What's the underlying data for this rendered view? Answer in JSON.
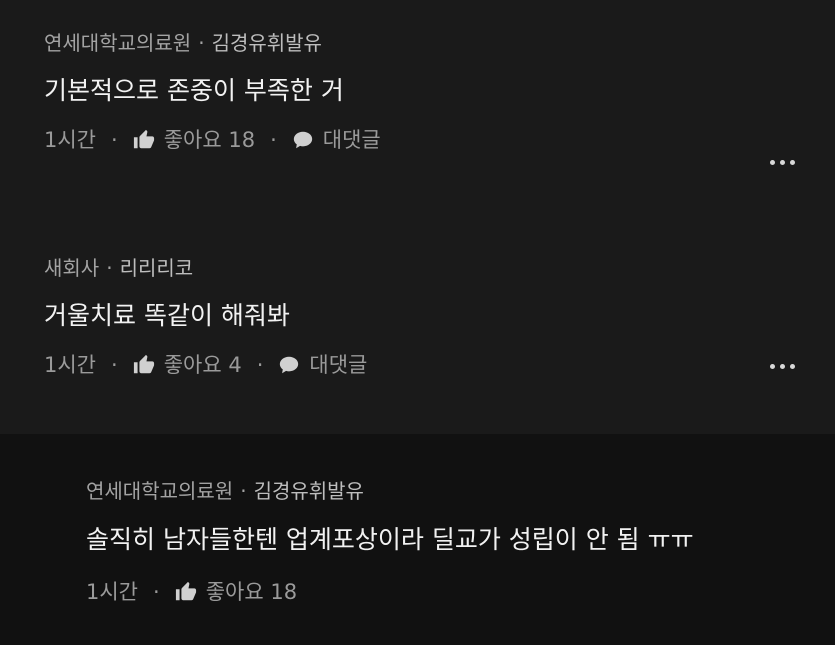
{
  "comments": [
    {
      "org": "연세대학교의료원",
      "author": "김경유휘발유",
      "text": "기본적으로 존중이 부족한 거",
      "time": "1시간",
      "like_label": "좋아요",
      "like_count": "18",
      "reply_label": "대댓글"
    },
    {
      "org": "새회사",
      "author": "리리리코",
      "text": "거울치료 똑같이 해줘봐",
      "time": "1시간",
      "like_label": "좋아요",
      "like_count": "4",
      "reply_label": "대댓글"
    }
  ],
  "reply": {
    "org": "연세대학교의료원",
    "author": "김경유휘발유",
    "text": "솔직히 남자들한텐 업계포상이라 딜교가 성립이 안 됨 ㅠㅠ",
    "time": "1시간",
    "like_label": "좋아요",
    "like_count": "18"
  },
  "separator": "·",
  "icons": {
    "like": "thumbs-up-icon",
    "reply": "speech-bubble-icon",
    "more": "more-options-icon"
  },
  "colors": {
    "background": "#1a1a1a",
    "reply_background": "#111111",
    "text": "#f2f2f2",
    "muted": "#9a9a9a"
  }
}
